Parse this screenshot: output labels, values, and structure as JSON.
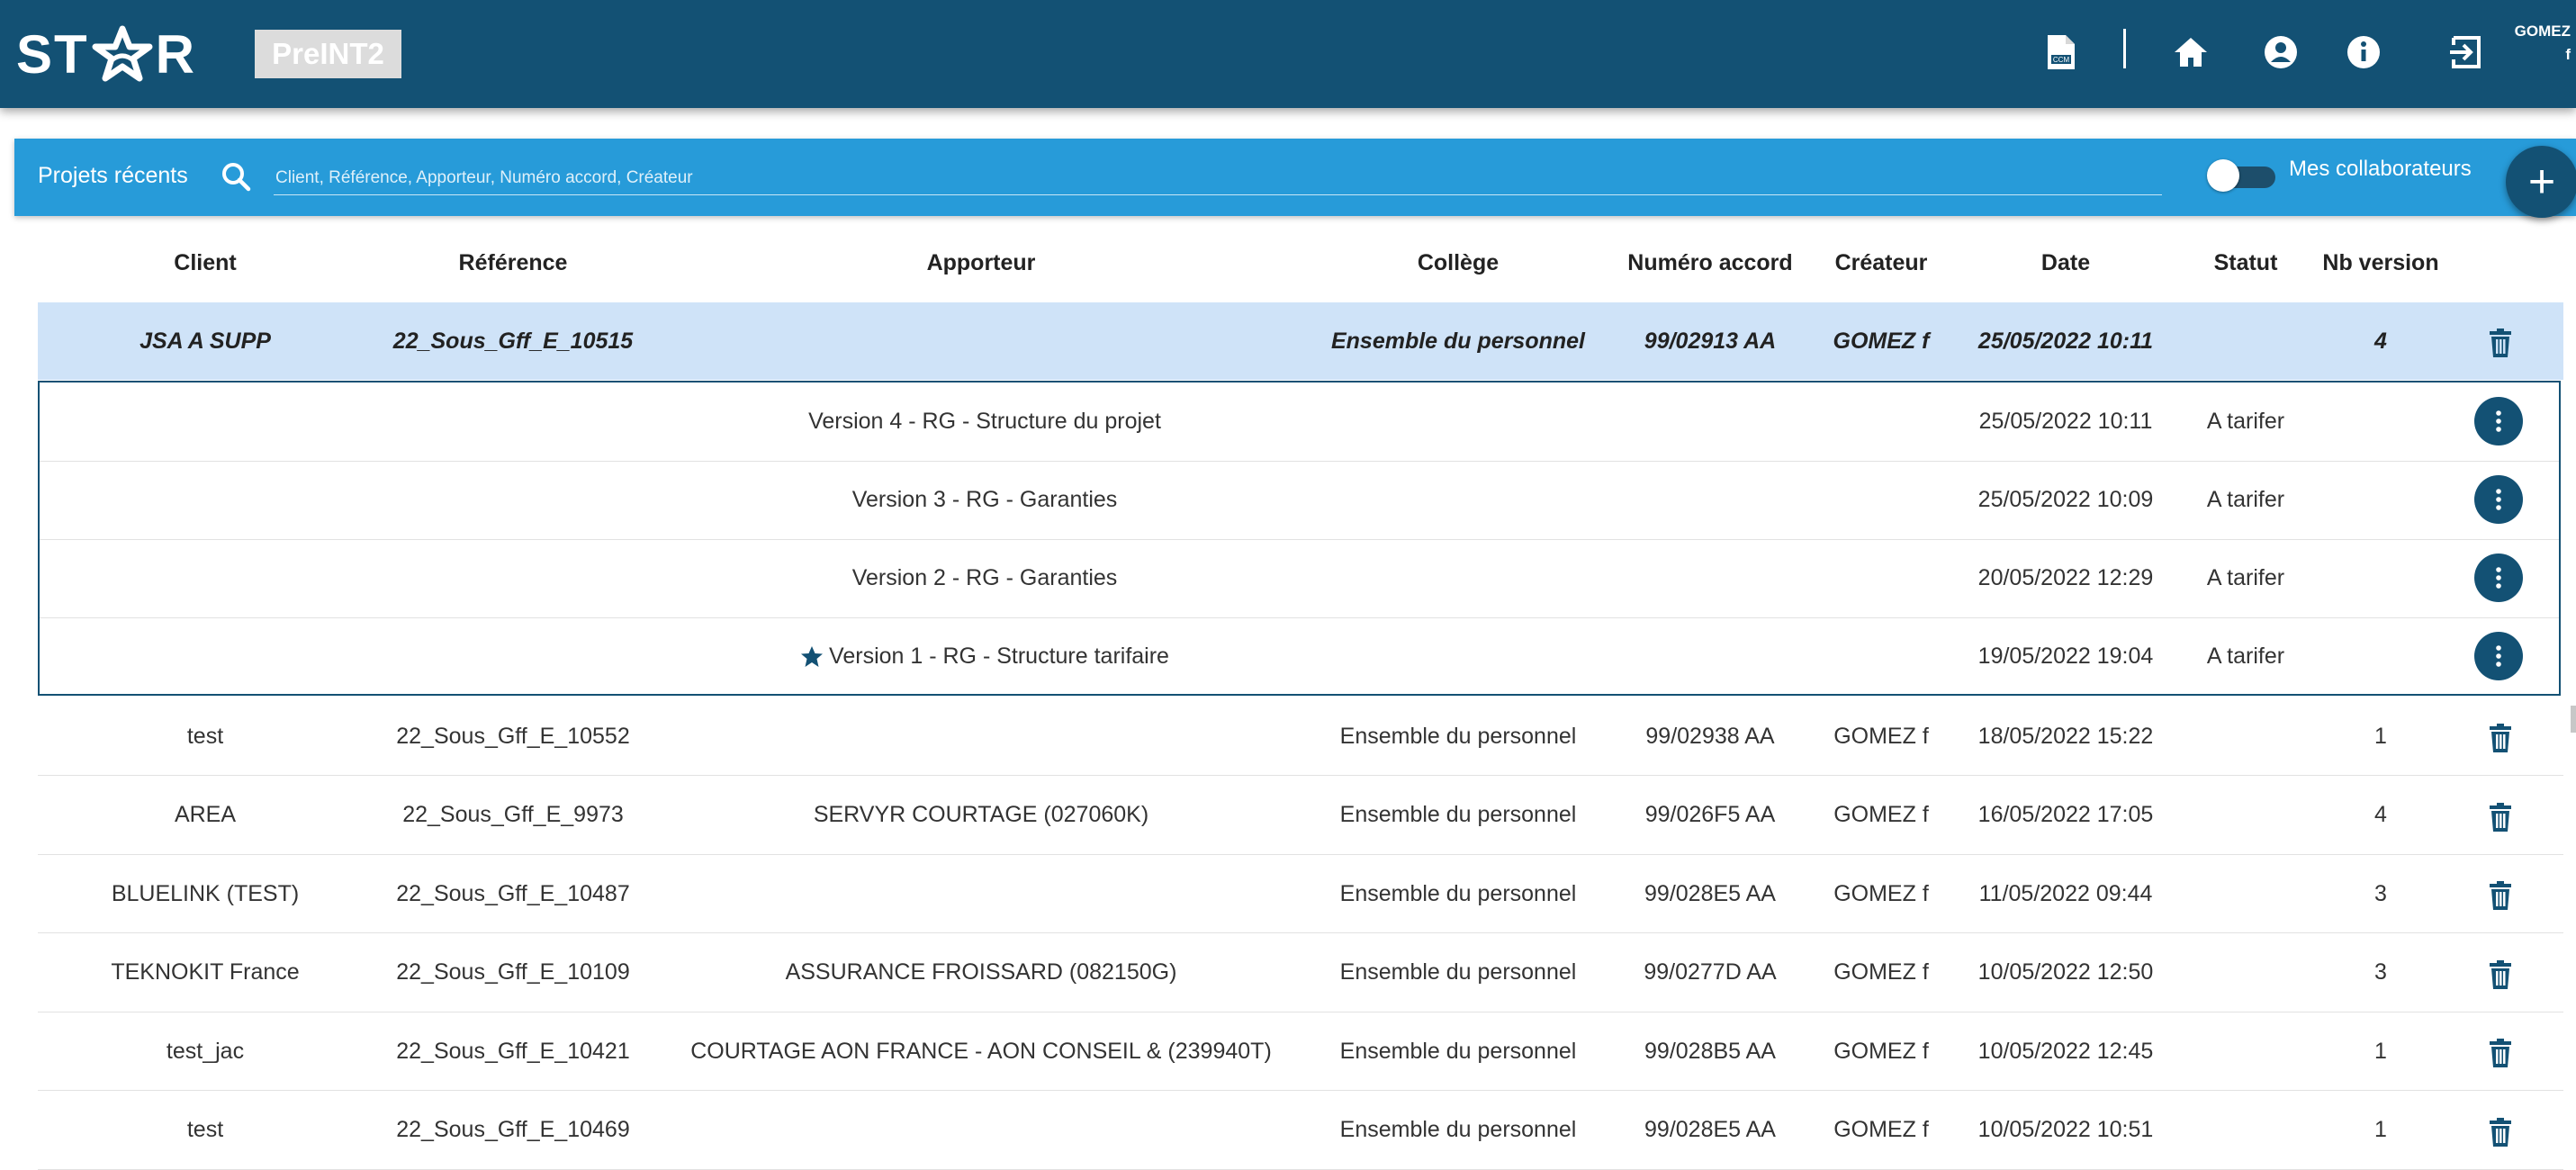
{
  "app": {
    "logo_text": "STAR",
    "env_label": "PreINT2"
  },
  "header": {
    "icons": [
      "ccm-document-icon",
      "home-icon",
      "account-icon",
      "info-icon",
      "logout-icon"
    ],
    "user_line1": "GOMEZ",
    "user_line2": "f"
  },
  "searchbar": {
    "title": "Projets récents",
    "placeholder": "Client, Référence, Apporteur, Numéro accord, Créateur",
    "toggle_label": "Mes collaborateurs",
    "toggle_on": false,
    "add_label": "+"
  },
  "colors": {
    "brand": "#135174",
    "accent": "#279bd9",
    "selected_row": "#cfe3f8"
  },
  "table": {
    "columns": [
      "Client",
      "Référence",
      "Apporteur",
      "Collège",
      "Numéro accord",
      "Créateur",
      "Date",
      "Statut",
      "Nb version"
    ],
    "selected_project": {
      "client": "JSA A SUPP",
      "reference": "22_Sous_Gff_E_10515",
      "apporteur": "",
      "college": "Ensemble du personnel",
      "numero_accord": "99/02913 AA",
      "createur": "GOMEZ f",
      "date": "25/05/2022 10:11",
      "statut": "",
      "nb_version": "4"
    },
    "versions": [
      {
        "label": "Version 4 - RG - Structure du projet",
        "date": "25/05/2022 10:11",
        "statut": "A tarifer",
        "starred": false
      },
      {
        "label": "Version 3 - RG - Garanties",
        "date": "25/05/2022 10:09",
        "statut": "A tarifer",
        "starred": false
      },
      {
        "label": "Version 2 - RG - Garanties",
        "date": "20/05/2022 12:29",
        "statut": "A tarifer",
        "starred": false
      },
      {
        "label": "Version 1 - RG - Structure tarifaire",
        "date": "19/05/2022 19:04",
        "statut": "A tarifer",
        "starred": true
      }
    ],
    "rows": [
      {
        "client": "test",
        "reference": "22_Sous_Gff_E_10552",
        "apporteur": "",
        "college": "Ensemble du personnel",
        "numero_accord": "99/02938 AA",
        "createur": "GOMEZ f",
        "date": "18/05/2022 15:22",
        "statut": "",
        "nb_version": "1"
      },
      {
        "client": "AREA",
        "reference": "22_Sous_Gff_E_9973",
        "apporteur": "SERVYR COURTAGE (027060K)",
        "college": "Ensemble du personnel",
        "numero_accord": "99/026F5 AA",
        "createur": "GOMEZ f",
        "date": "16/05/2022 17:05",
        "statut": "",
        "nb_version": "4"
      },
      {
        "client": "BLUELINK (TEST)",
        "reference": "22_Sous_Gff_E_10487",
        "apporteur": "",
        "college": "Ensemble du personnel",
        "numero_accord": "99/028E5 AA",
        "createur": "GOMEZ f",
        "date": "11/05/2022 09:44",
        "statut": "",
        "nb_version": "3"
      },
      {
        "client": "TEKNOKIT France",
        "reference": "22_Sous_Gff_E_10109",
        "apporteur": "ASSURANCE FROISSARD (082150G)",
        "college": "Ensemble du personnel",
        "numero_accord": "99/0277D AA",
        "createur": "GOMEZ f",
        "date": "10/05/2022 12:50",
        "statut": "",
        "nb_version": "3"
      },
      {
        "client": "test_jac",
        "reference": "22_Sous_Gff_E_10421",
        "apporteur": "COURTAGE AON FRANCE - AON CONSEIL & (239940T)",
        "college": "Ensemble du personnel",
        "numero_accord": "99/028B5 AA",
        "createur": "GOMEZ f",
        "date": "10/05/2022 12:45",
        "statut": "",
        "nb_version": "1"
      },
      {
        "client": "test",
        "reference": "22_Sous_Gff_E_10469",
        "apporteur": "",
        "college": "Ensemble du personnel",
        "numero_accord": "99/028E5 AA",
        "createur": "GOMEZ f",
        "date": "10/05/2022 10:51",
        "statut": "",
        "nb_version": "1"
      }
    ]
  }
}
